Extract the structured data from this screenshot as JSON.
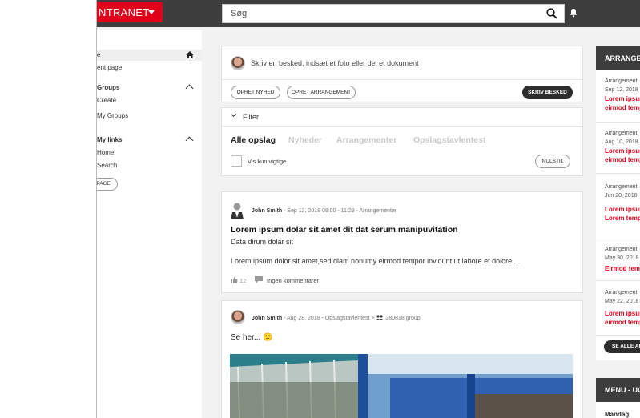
{
  "topbar": {
    "brand": "NTRANET",
    "search_placeholder": "Søg"
  },
  "sidebar": {
    "home": "e",
    "current_page": "ent page",
    "groups_header": "Groups",
    "groups_create": "Create",
    "groups_my": "My Groups",
    "links_header": "My links",
    "links_home": "Home",
    "links_search": "Search",
    "page_button": "PAGE"
  },
  "composer": {
    "placeholder": "Skriv en besked, indsæt et foto eller del et dokument",
    "btn_news": "OPRET NYHED",
    "btn_event": "OPRET ARRANGEMENT",
    "btn_send": "SKRIV BESKED"
  },
  "filter": {
    "label": "Filter",
    "tabs": [
      "Alle opslag",
      "Nyheder",
      "Arrangementer",
      "Opslagstavlentest"
    ],
    "checkbox_label": "Vis kun vigtige",
    "reset_button": "NULSTIL"
  },
  "post1": {
    "author": "John Smith",
    "meta": "- Sep 12, 2018 09:00 - 11:29 - Arrangementer",
    "title": "Lorem ipsum dolar sit amet dit dat serum manipuvitation",
    "subtitle": "Data dirum dolar sit",
    "body": "Lorem ipsum dolor sit amet,sed diam nonumy eirmod tempor invidunt ut labore et dolore ...",
    "likes": "12",
    "comments": "Ingen kommentarer"
  },
  "post2": {
    "author": "John Smith",
    "meta": "- Aug 28, 2018 - Opslagstavlentest",
    "group_arrow": ">",
    "group": "280818 group",
    "text": "Se her...",
    "emoji": "🙂"
  },
  "right_panel": {
    "header": "ARRANGEMENTER",
    "items": [
      {
        "type": "Arrangement",
        "date": "Sep 12, 2018",
        "l1": "Lorem ipsum",
        "l2": "eirmod tempor"
      },
      {
        "type": "Arrangement",
        "date": "Aug 10, 2018",
        "l1": "Lorem ipsum",
        "l2": "eirmod tempor"
      },
      {
        "type": "Arrangement",
        "date": "Jun 20, 2018",
        "l1": "Lorem ipsum",
        "l2": "Lorem tempor"
      },
      {
        "type": "Arrangement",
        "date": "May 30, 2018",
        "l1": "Eirmod tempor",
        "l2": ""
      },
      {
        "type": "Arrangement",
        "date": "May 22, 2018",
        "l1": "Lorem ipsum",
        "l2": "eirmod tempor"
      }
    ],
    "see_all": "SE ALLE ARRANGEMENTER",
    "menu_header": "MENU - UGE",
    "menu_day": "Mandag"
  }
}
